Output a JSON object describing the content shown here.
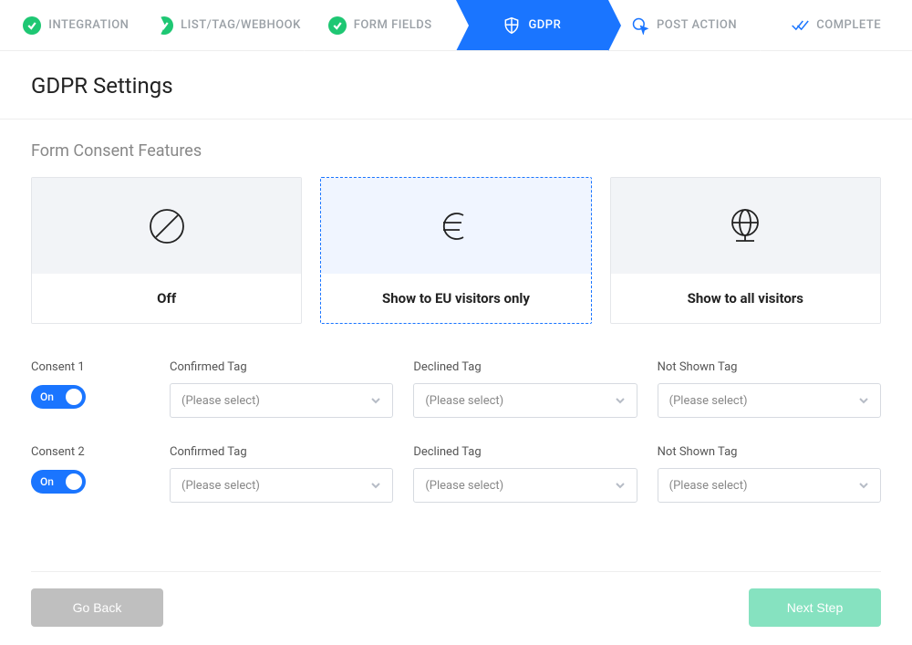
{
  "wizard": [
    {
      "label": "INTEGRATION",
      "state": "done"
    },
    {
      "label": "LIST/TAG/WEBHOOK",
      "state": "done"
    },
    {
      "label": "FORM FIELDS",
      "state": "done"
    },
    {
      "label": "GDPR",
      "state": "active"
    },
    {
      "label": "POST ACTION",
      "state": "pending"
    },
    {
      "label": "COMPLETE",
      "state": "pending"
    }
  ],
  "page_title": "GDPR Settings",
  "section_title": "Form Consent Features",
  "cards": {
    "off": "Off",
    "eu": "Show to EU visitors only",
    "all": "Show to all visitors"
  },
  "toggle_state": "On",
  "consents": [
    {
      "title": "Consent 1"
    },
    {
      "title": "Consent 2"
    }
  ],
  "tag_labels": {
    "confirmed": "Confirmed Tag",
    "declined": "Declined Tag",
    "notshown": "Not Shown Tag"
  },
  "select_placeholder": "(Please select)",
  "buttons": {
    "back": "Go Back",
    "next": "Next Step"
  }
}
